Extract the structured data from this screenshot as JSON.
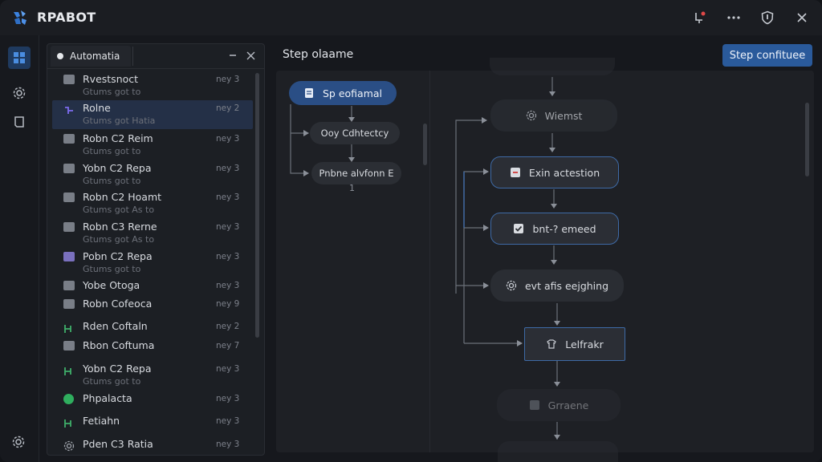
{
  "app": {
    "title": "RPABOT"
  },
  "sidebar": {
    "tab_label": "Automatia",
    "items": [
      {
        "title": "Rvestsnoct",
        "subtitle": "Gtums got to",
        "meta": "ney 3",
        "icon": "file-icon",
        "icon_color": "#8a8f99"
      },
      {
        "title": "Rolne",
        "subtitle": "Gtums got Hatia",
        "meta": "ney 2",
        "icon": "branch-icon",
        "icon_color": "#7d6cf0",
        "selected": true
      },
      {
        "title": "Robn C2 Reim",
        "subtitle": "Gtums got to",
        "meta": "ney 3",
        "icon": "file-icon",
        "icon_color": "#8a8f99"
      },
      {
        "title": "Yobn C2 Repa",
        "subtitle": "Gtums got to",
        "meta": "ney 3",
        "icon": "file-icon",
        "icon_color": "#8a8f99"
      },
      {
        "title": "Robn C2 Hoamt",
        "subtitle": "Gtums got As to",
        "meta": "ney 3",
        "icon": "file-icon",
        "icon_color": "#8a8f99"
      },
      {
        "title": "Robn C3 Rerne",
        "subtitle": "Gtums got As to",
        "meta": "ney 3",
        "icon": "file-icon",
        "icon_color": "#8a8f99"
      },
      {
        "title": "Pobn C2 Repa",
        "subtitle": "Gtums got to",
        "meta": "ney 3",
        "icon": "file-icon",
        "icon_color": "#8b7fd9"
      },
      {
        "title": "Yobe Otoga",
        "subtitle": "",
        "meta": "ney 3",
        "icon": "file-icon",
        "icon_color": "#8a8f99"
      },
      {
        "title": "Robn Cofeoca",
        "subtitle": "",
        "meta": "ney 9",
        "icon": "file-icon",
        "icon_color": "#8a8f99"
      },
      {
        "title": "Rden Coftaln",
        "subtitle": "",
        "meta": "ney 2",
        "icon": "flow-icon",
        "icon_color": "#3fae6a"
      },
      {
        "title": "Rbon Coftuma",
        "subtitle": "",
        "meta": "ney 7",
        "icon": "file-icon",
        "icon_color": "#8a8f99"
      },
      {
        "title": "Yobn C2 Repa",
        "subtitle": "Gtums got to",
        "meta": "ney 3",
        "icon": "flow-icon",
        "icon_color": "#3fae6a"
      },
      {
        "title": "Phpalacta",
        "subtitle": "",
        "meta": "ney 3",
        "icon": "circle-icon",
        "icon_color": "#2fae5e"
      },
      {
        "title": "Fetiahn",
        "subtitle": "",
        "meta": "ney 3",
        "icon": "flow-icon",
        "icon_color": "#3fae6a"
      },
      {
        "title": "Pden C3 Ratia",
        "subtitle": "",
        "meta": "ney 3",
        "icon": "gear-icon",
        "icon_color": "#9ea3ab"
      }
    ]
  },
  "main": {
    "title": "Step olaame",
    "primary_button": "Step confituee",
    "left_flow": {
      "start": "Sp eofiamal",
      "step1": "Ooy Cdhtectcy",
      "step2": "Pnbne alvfonn E",
      "step2_note": "1"
    },
    "right_flow": {
      "n1": "Wiemst",
      "n2": "Exin actestion",
      "n3": "bnt-? emeed",
      "n4": "evt afis eejghing",
      "n5": "Lelfrakr",
      "n6": "Grraene"
    }
  },
  "colors": {
    "accent": "#2a5a9b",
    "selected_row": "#243047",
    "node_highlight_border": "#3e6aa6"
  }
}
